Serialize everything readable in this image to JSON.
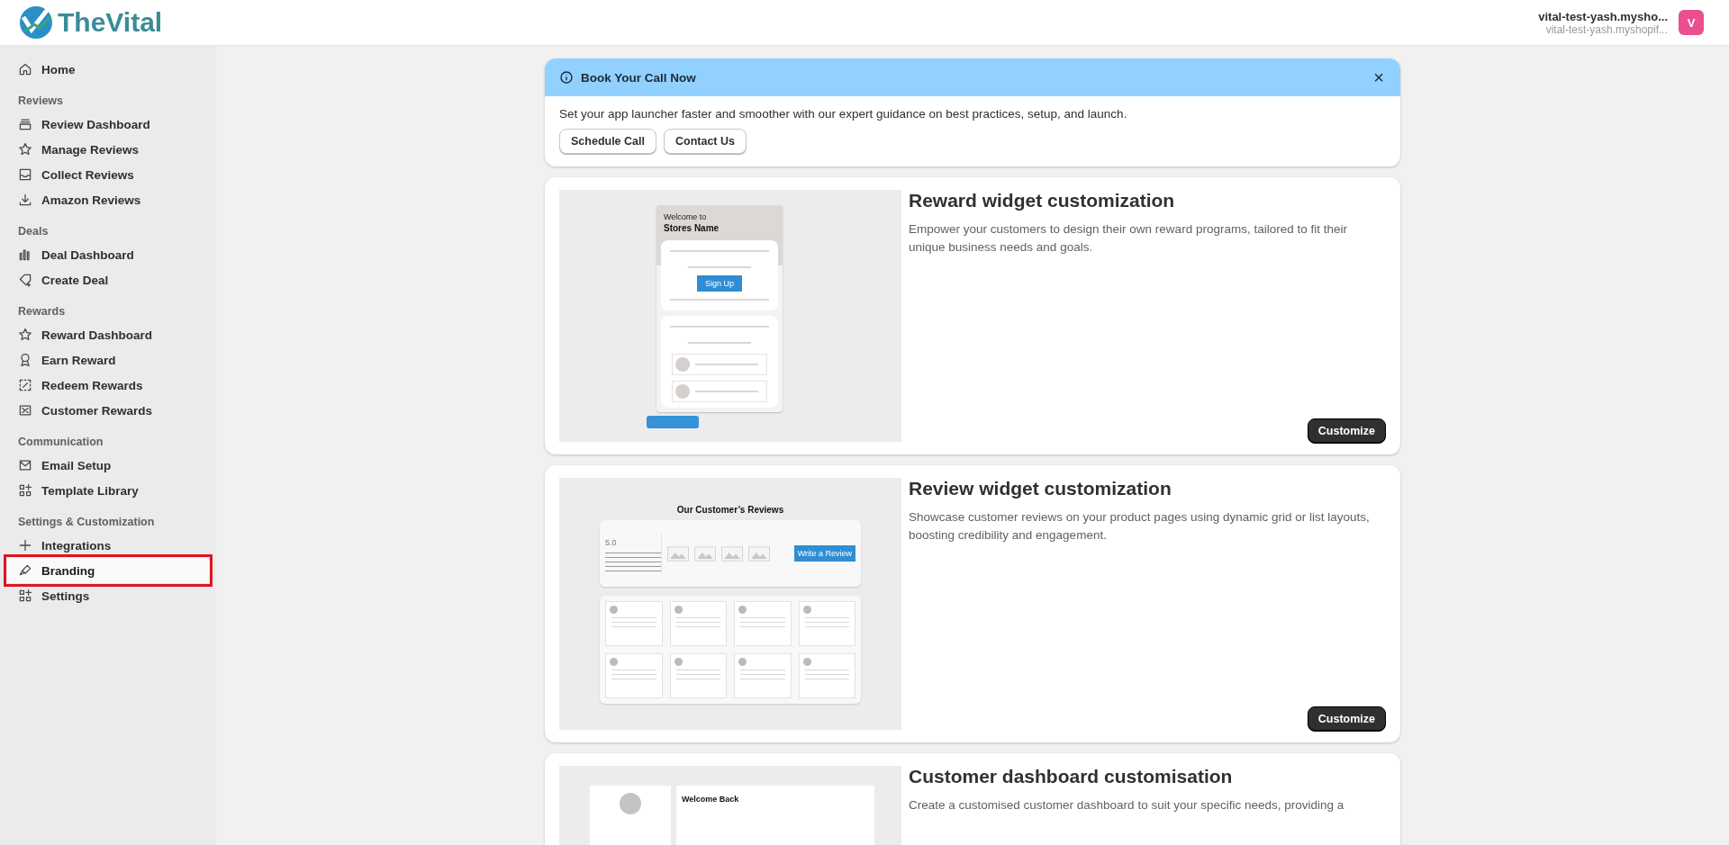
{
  "header": {
    "logo": "TheVital",
    "store_name": "vital-test-yash.mysho...",
    "store_domain": "vital-test-yash.myshopif...",
    "avatar": "V"
  },
  "sidebar": {
    "sections": [
      {
        "items": [
          {
            "label": "Home",
            "selected": false
          }
        ]
      },
      {
        "title": "Reviews",
        "items": [
          {
            "label": "Review Dashboard",
            "selected": false
          },
          {
            "label": "Manage Reviews",
            "selected": false
          },
          {
            "label": "Collect Reviews",
            "selected": false
          },
          {
            "label": "Amazon Reviews",
            "selected": false
          }
        ]
      },
      {
        "title": "Deals",
        "items": [
          {
            "label": "Deal Dashboard",
            "selected": false
          },
          {
            "label": "Create Deal",
            "selected": false
          }
        ]
      },
      {
        "title": "Rewards",
        "items": [
          {
            "label": "Reward Dashboard",
            "selected": false
          },
          {
            "label": "Earn Reward",
            "selected": false
          },
          {
            "label": "Redeem Rewards",
            "selected": false
          },
          {
            "label": "Customer Rewards",
            "selected": false
          }
        ]
      },
      {
        "title": "Communication",
        "items": [
          {
            "label": "Email Setup",
            "selected": false
          },
          {
            "label": "Template Library",
            "selected": false
          }
        ]
      },
      {
        "title": "Settings & Customization",
        "items": [
          {
            "label": "Integrations",
            "selected": false
          },
          {
            "label": "Branding",
            "selected": true
          },
          {
            "label": "Settings",
            "selected": false
          }
        ]
      }
    ]
  },
  "banner": {
    "title": "Book Your Call Now",
    "close": "×",
    "text": "Set your app launcher faster and smoother with our expert guidance on best practices, setup, and launch.",
    "buttons": [
      "Schedule Call",
      "Contact Us"
    ]
  },
  "cards": [
    {
      "kind": "reward",
      "title": "Reward widget customization",
      "description": "Empower your customers to design their own reward programs, tailored to fit their unique business needs and goals.",
      "button": "Customize",
      "preview": {
        "texts": [
          "Welcome to",
          "Stores Name",
          "Sign Up"
        ]
      }
    },
    {
      "kind": "review",
      "title": "Review widget customization",
      "description": "Showcase customer reviews on your product pages using dynamic grid or list layouts, boosting credibility and engagement.",
      "button": "Customize",
      "preview": {
        "texts": [
          "Our Customer’s Reviews",
          "5.0",
          "Write a Review"
        ]
      }
    },
    {
      "kind": "dashboard",
      "title": "Customer dashboard customisation",
      "description": "Create a customised customer dashboard to suit your specific needs, providing a",
      "preview": {
        "texts": [
          "Welcome Back"
        ]
      }
    }
  ]
}
